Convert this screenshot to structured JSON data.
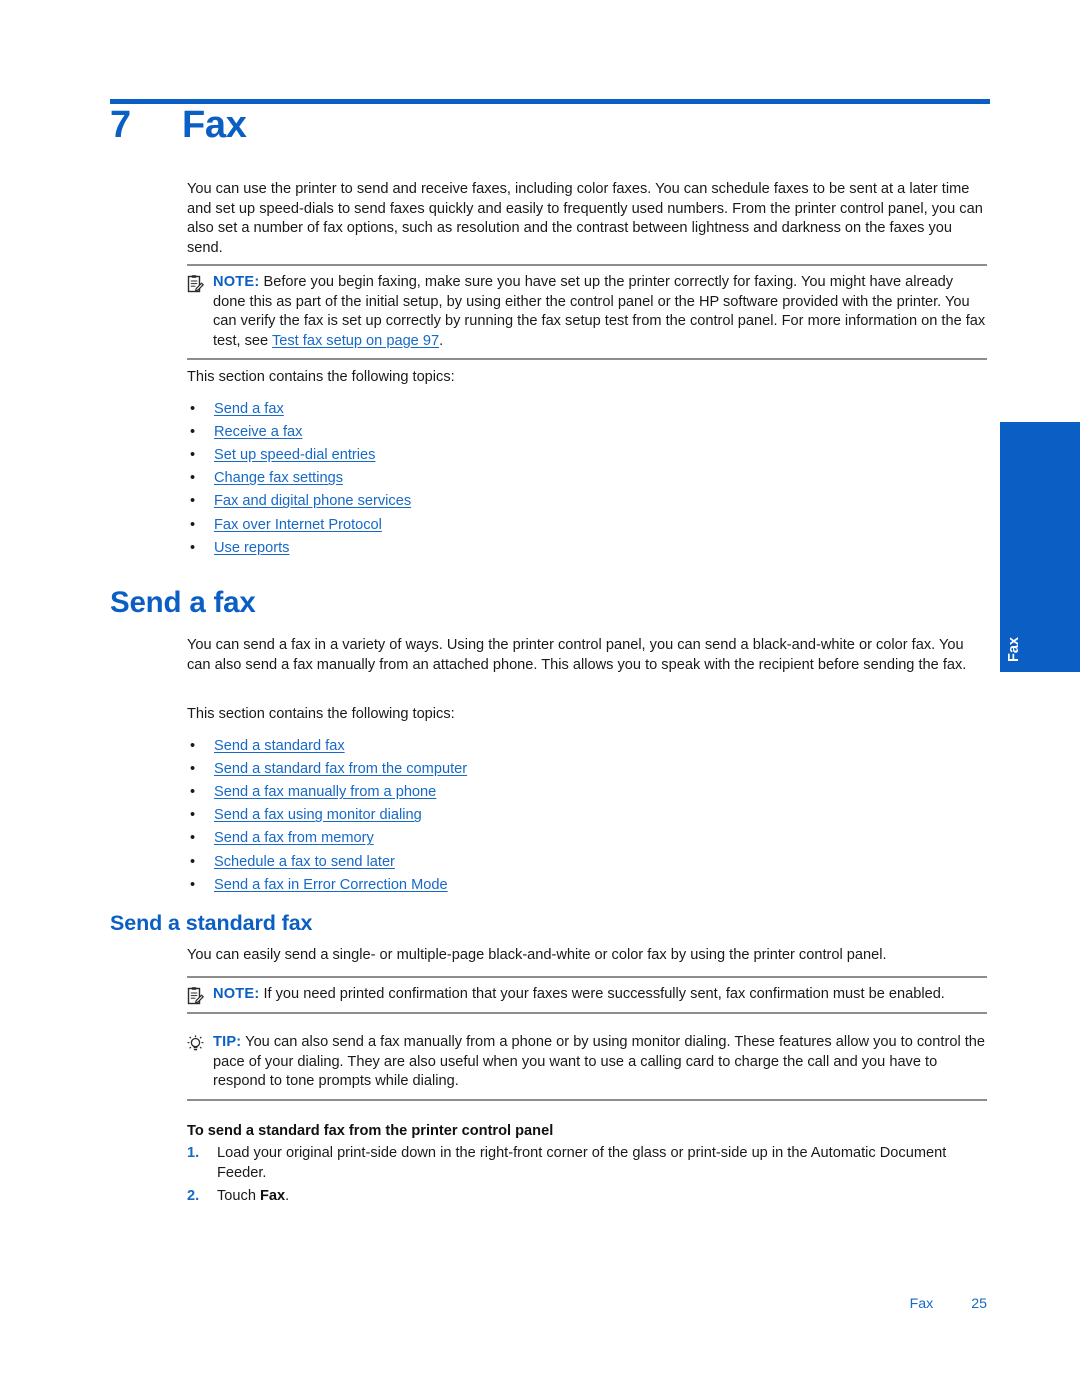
{
  "chapter": {
    "number": "7",
    "title": "Fax"
  },
  "intro": {
    "paragraph": "You can use the printer to send and receive faxes, including color faxes. You can schedule faxes to be sent at a later time and set up speed-dials to send faxes quickly and easily to frequently used numbers. From the printer control panel, you can also set a number of fax options, such as resolution and the contrast between lightness and darkness on the faxes you send."
  },
  "note_chapter": {
    "icon": "note-clipboard-icon",
    "label": "NOTE:",
    "text_before_link": "Before you begin faxing, make sure you have set up the printer correctly for faxing. You might have already done this as part of the initial setup, by using either the control panel or the HP software provided with the printer. You can verify the fax is set up correctly by running the fax setup test from the control panel. For more information on the fax test, see ",
    "link": "Test fax setup on page 97",
    "text_after_link": "."
  },
  "chapter_topics": {
    "lead_in": "This section contains the following topics:",
    "bullet": "•",
    "items": [
      "Send a fax",
      "Receive a fax",
      "Set up speed-dial entries",
      "Change fax settings",
      "Fax and digital phone services",
      "Fax over Internet Protocol",
      "Use reports"
    ]
  },
  "send_a_fax": {
    "heading": "Send a fax",
    "paragraph": "You can send a fax in a variety of ways. Using the printer control panel, you can send a black-and-white or color fax. You can also send a fax manually from an attached phone. This allows you to speak with the recipient before sending the fax.",
    "topics": {
      "lead_in": "This section contains the following topics:",
      "items": [
        "Send a standard fax",
        "Send a standard fax from the computer",
        "Send a fax manually from a phone",
        "Send a fax using monitor dialing",
        "Send a fax from memory",
        "Schedule a fax to send later",
        "Send a fax in Error Correction Mode"
      ]
    }
  },
  "send_standard_fax": {
    "heading": "Send a standard fax",
    "paragraph": "You can easily send a single- or multiple-page black-and-white or color fax by using the printer control panel.",
    "note": {
      "icon": "note-clipboard-icon",
      "label": "NOTE:",
      "text": "If you need printed confirmation that your faxes were successfully sent, fax confirmation must be enabled."
    },
    "tip": {
      "icon": "lightbulb-icon",
      "label": "TIP:",
      "text": "You can also send a fax manually from a phone or by using monitor dialing. These features allow you to control the pace of your dialing. They are also useful when you want to use a calling card to charge the call and you have to respond to tone prompts while dialing."
    },
    "procedure": {
      "title": "To send a standard fax from the printer control panel",
      "steps": [
        {
          "marker": "1.",
          "text": "Load your original print-side down in the right-front corner of the glass or print-side up in the Automatic Document Feeder."
        },
        {
          "marker": "2.",
          "text_before_bold": "Touch ",
          "bold": "Fax",
          "text_after_bold": "."
        }
      ]
    }
  },
  "thumb_tab": {
    "label": "Fax"
  },
  "footer": {
    "label": "Fax",
    "page": "25"
  },
  "colors": {
    "brand_blue": "#0B5FC4",
    "link_blue": "#1769C8",
    "rule_gray": "#8d8d8d"
  }
}
